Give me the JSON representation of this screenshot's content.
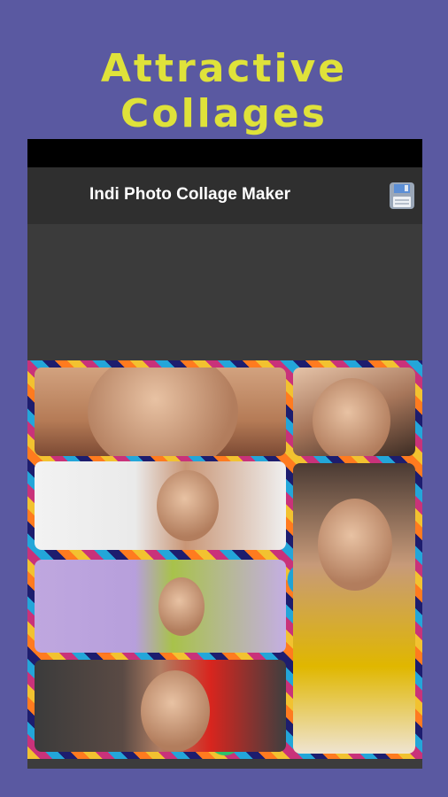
{
  "headline": "Attractive Collages",
  "app": {
    "toolbar_title": "Indi Photo Collage Maker",
    "save_icon": "floppy-disk-icon"
  },
  "collage": {
    "tiles": [
      {
        "name": "photo-eyes-closeup"
      },
      {
        "name": "photo-smiling-woman"
      },
      {
        "name": "photo-woman-white-background"
      },
      {
        "name": "photo-woman-yellow-shirt-book"
      },
      {
        "name": "photo-woman-green-scarf"
      },
      {
        "name": "photo-woman-red-earrings"
      }
    ]
  },
  "colors": {
    "background": "#5a59a1",
    "headline": "#dfe23a",
    "toolbar": "#2f2f2f",
    "status_bar": "#000000"
  }
}
